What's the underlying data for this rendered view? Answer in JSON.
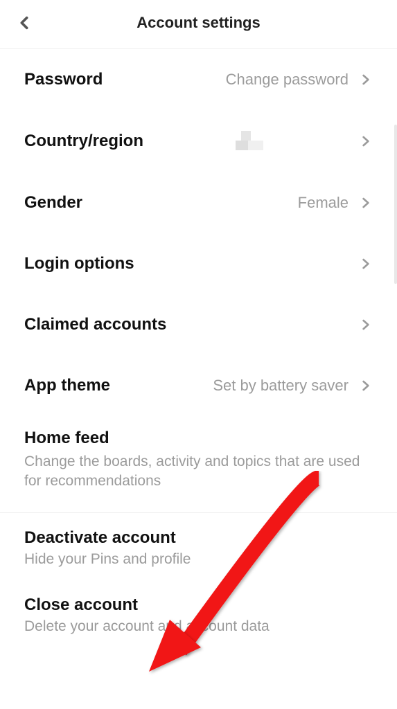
{
  "header": {
    "title": "Account settings"
  },
  "settings": {
    "password": {
      "label": "Password",
      "value": "Change password"
    },
    "country": {
      "label": "Country/region"
    },
    "gender": {
      "label": "Gender",
      "value": "Female"
    },
    "login": {
      "label": "Login options"
    },
    "claimed": {
      "label": "Claimed accounts"
    },
    "theme": {
      "label": "App theme",
      "value": "Set by battery saver"
    }
  },
  "homefeed": {
    "title": "Home feed",
    "subtitle": "Change the boards, activity and topics that are used for recommendations"
  },
  "deactivate": {
    "title": "Deactivate account",
    "subtitle": "Hide your Pins and profile"
  },
  "close": {
    "title": "Close account",
    "subtitle": "Delete your account and account data"
  }
}
